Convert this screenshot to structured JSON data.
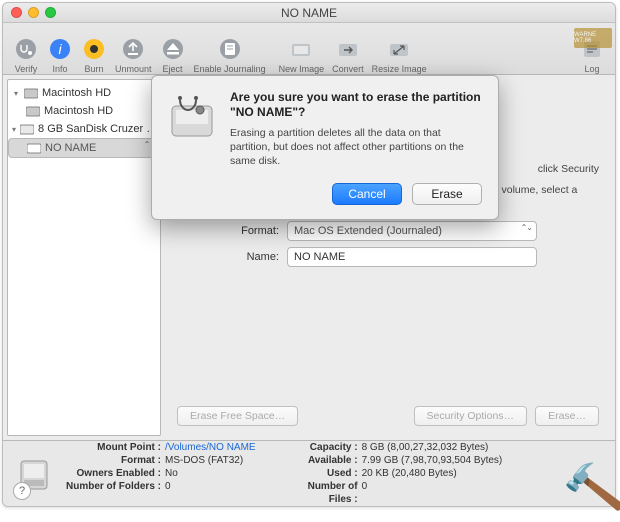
{
  "window": {
    "title": "NO NAME"
  },
  "toolbar": {
    "verify": "Verify",
    "info": "Info",
    "burn": "Burn",
    "unmount": "Unmount",
    "eject": "Eject",
    "enable_journaling": "Enable Journaling",
    "new_image": "New Image",
    "convert": "Convert",
    "resize_image": "Resize Image",
    "log": "Log"
  },
  "sidebar": {
    "items": [
      {
        "label": "Macintosh HD",
        "indent": 0,
        "expandable": true,
        "sel": false,
        "icon": "hdd"
      },
      {
        "label": "Macintosh HD",
        "indent": 1,
        "expandable": false,
        "sel": false,
        "icon": "hdd"
      },
      {
        "label": "8 GB SanDisk Cruzer …",
        "indent": 0,
        "expandable": true,
        "sel": false,
        "icon": "usb"
      },
      {
        "label": "NO NAME",
        "indent": 1,
        "expandable": false,
        "sel": true,
        "icon": "usb"
      }
    ]
  },
  "main": {
    "security_hint_fragment": "click Security",
    "prevent_hint": "To prevent the recovery of previously deleted files without erasing the volume, select a volume in the list on the left, and click Erase Free Space.",
    "format_label": "Format:",
    "format_value": "Mac OS Extended (Journaled)",
    "name_label": "Name:",
    "name_value": "NO NAME",
    "btn_erase_free": "Erase Free Space…",
    "btn_security": "Security Options…",
    "btn_erase": "Erase…"
  },
  "modal": {
    "title": "Are you sure you want to erase the partition \"NO NAME\"?",
    "body": "Erasing a partition deletes all the data on that partition, but does not affect other partitions on the same disk.",
    "cancel": "Cancel",
    "erase": "Erase"
  },
  "footer": {
    "mount_point_k": "Mount Point :",
    "mount_point_v": "/Volumes/NO NAME",
    "format_k": "Format :",
    "format_v": "MS-DOS (FAT32)",
    "owners_k": "Owners Enabled :",
    "owners_v": "No",
    "folders_k": "Number of Folders :",
    "folders_v": "0",
    "capacity_k": "Capacity :",
    "capacity_v": "8 GB (8,00,27,32,032 Bytes)",
    "available_k": "Available :",
    "available_v": "7.99 GB (7,98,70,93,504 Bytes)",
    "used_k": "Used :",
    "used_v": "20 KB (20,480 Bytes)",
    "files_k": "Number of Files :",
    "files_v": "0",
    "help": "?"
  },
  "watermark": "WARNE W7.86"
}
